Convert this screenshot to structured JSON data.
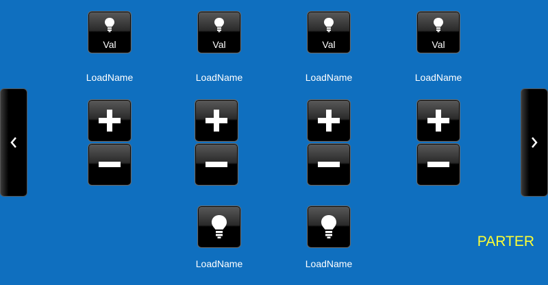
{
  "loads_top": [
    {
      "value": "Val",
      "name": "LoadName"
    },
    {
      "value": "Val",
      "name": "LoadName"
    },
    {
      "value": "Val",
      "name": "LoadName"
    },
    {
      "value": "Val",
      "name": "LoadName"
    }
  ],
  "loads_bottom": [
    {
      "name": "LoadName"
    },
    {
      "name": "LoadName"
    }
  ],
  "floor_label": "PARTER",
  "icons": {
    "load": "lightbulb-icon",
    "increase": "plus-icon",
    "decrease": "minus-icon",
    "prev": "chevron-left-icon",
    "next": "chevron-right-icon"
  },
  "colors": {
    "background": "#0f6fbf",
    "button": "#000000",
    "floor_label": "#ffff33",
    "text": "#ffffff"
  }
}
